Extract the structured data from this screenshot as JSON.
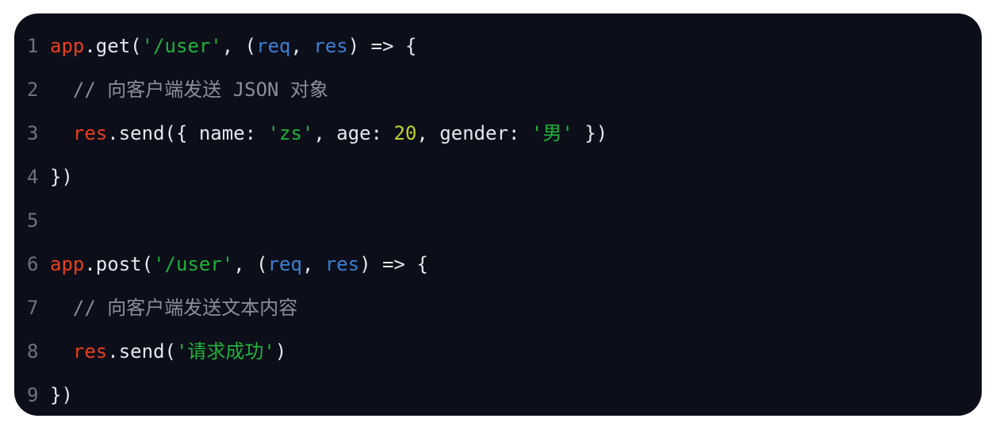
{
  "code": {
    "line_numbers": [
      "1",
      "2",
      "3",
      "4",
      "5",
      "6",
      "7",
      "8",
      "9"
    ],
    "lines": [
      [
        {
          "t": "obj",
          "text": "app"
        },
        {
          "t": "plain",
          "text": ".get("
        },
        {
          "t": "str",
          "text": "'/user'"
        },
        {
          "t": "plain",
          "text": ", ("
        },
        {
          "t": "param",
          "text": "req"
        },
        {
          "t": "plain",
          "text": ", "
        },
        {
          "t": "param",
          "text": "res"
        },
        {
          "t": "plain",
          "text": ") => {"
        }
      ],
      [
        {
          "t": "comment",
          "text": "  // 向客户端发送 JSON 对象"
        }
      ],
      [
        {
          "t": "plain",
          "text": "  "
        },
        {
          "t": "obj",
          "text": "res"
        },
        {
          "t": "plain",
          "text": ".send({ name: "
        },
        {
          "t": "str",
          "text": "'zs'"
        },
        {
          "t": "plain",
          "text": ", age: "
        },
        {
          "t": "num",
          "text": "20"
        },
        {
          "t": "plain",
          "text": ", gender: "
        },
        {
          "t": "str",
          "text": "'男'"
        },
        {
          "t": "plain",
          "text": " })"
        }
      ],
      [
        {
          "t": "plain",
          "text": "})"
        }
      ],
      [],
      [
        {
          "t": "obj",
          "text": "app"
        },
        {
          "t": "plain",
          "text": ".post("
        },
        {
          "t": "str",
          "text": "'/user'"
        },
        {
          "t": "plain",
          "text": ", ("
        },
        {
          "t": "param",
          "text": "req"
        },
        {
          "t": "plain",
          "text": ", "
        },
        {
          "t": "param",
          "text": "res"
        },
        {
          "t": "plain",
          "text": ") => {"
        }
      ],
      [
        {
          "t": "comment",
          "text": "  // 向客户端发送文本内容"
        }
      ],
      [
        {
          "t": "plain",
          "text": "  "
        },
        {
          "t": "obj",
          "text": "res"
        },
        {
          "t": "plain",
          "text": ".send("
        },
        {
          "t": "str",
          "text": "'请求成功'"
        },
        {
          "t": "plain",
          "text": ")"
        }
      ],
      [
        {
          "t": "plain",
          "text": "})"
        }
      ]
    ]
  },
  "colors": {
    "background": "#0c0e1a",
    "object": "#e8401c",
    "string": "#1fb23a",
    "param": "#3b7fd1",
    "number": "#c3d12a",
    "comment": "#8a8f99",
    "text": "#e6e8ef",
    "line_number": "#6f7480"
  }
}
